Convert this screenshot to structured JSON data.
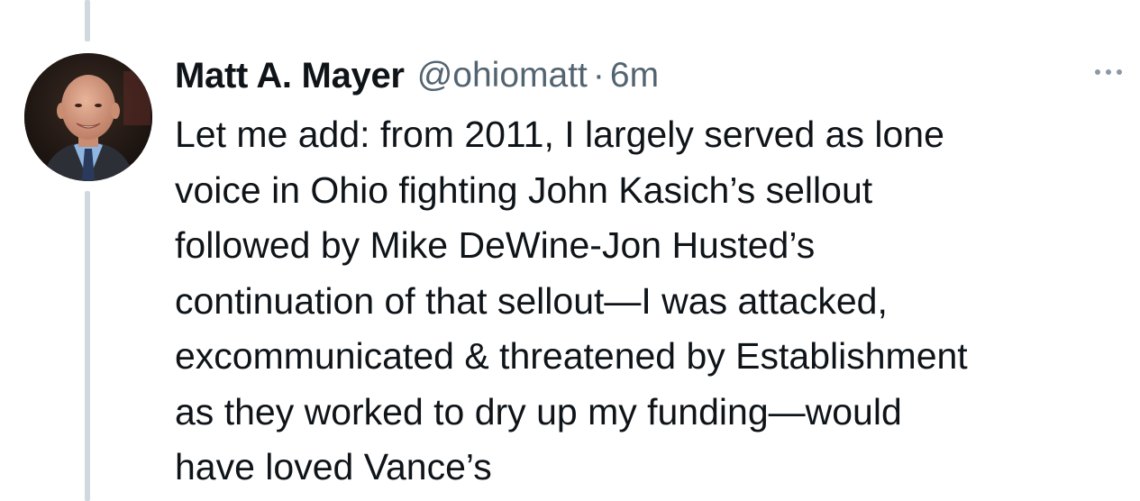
{
  "tweet": {
    "author_name": "Matt A. Mayer",
    "handle": "@ohiomatt",
    "separator": "·",
    "time": "6m",
    "text_lines": [
      "Let me add: from 2011, I largely served as lone",
      "voice in Ohio fighting John Kasich’s sellout",
      "followed by Mike DeWine-Jon Husted’s",
      "continuation of that sellout—I was attacked,",
      "excommunicated & threatened by Establishment",
      "as they worked to dry up my funding—would",
      "have loved Vance’s"
    ]
  },
  "icons": {
    "more": "more-horizontal-icon",
    "avatar": "profile-photo"
  },
  "colors": {
    "text": "#0f1419",
    "secondary": "#536471",
    "thread_line": "#cfd9de",
    "more_dots": "#8b98a5"
  }
}
